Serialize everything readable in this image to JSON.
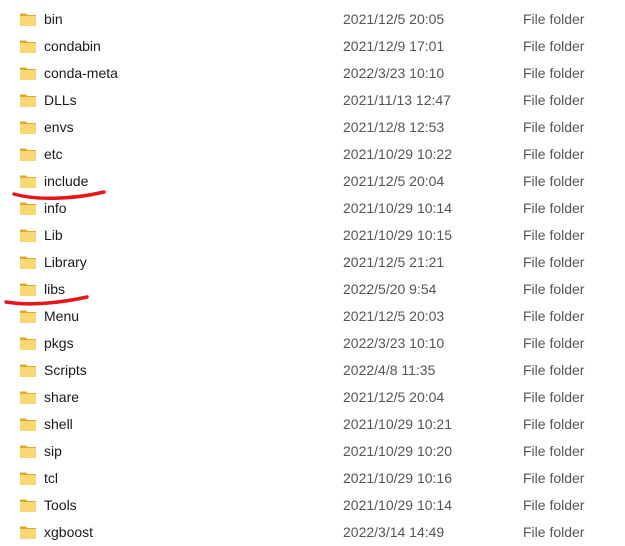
{
  "folders": [
    {
      "name": "bin",
      "date": "2021/12/5 20:05",
      "type": "File folder"
    },
    {
      "name": "condabin",
      "date": "2021/12/9 17:01",
      "type": "File folder"
    },
    {
      "name": "conda-meta",
      "date": "2022/3/23 10:10",
      "type": "File folder"
    },
    {
      "name": "DLLs",
      "date": "2021/11/13 12:47",
      "type": "File folder"
    },
    {
      "name": "envs",
      "date": "2021/12/8 12:53",
      "type": "File folder"
    },
    {
      "name": "etc",
      "date": "2021/10/29 10:22",
      "type": "File folder"
    },
    {
      "name": "include",
      "date": "2021/12/5 20:04",
      "type": "File folder",
      "underlined": true
    },
    {
      "name": "info",
      "date": "2021/10/29 10:14",
      "type": "File folder"
    },
    {
      "name": "Lib",
      "date": "2021/10/29 10:15",
      "type": "File folder"
    },
    {
      "name": "Library",
      "date": "2021/12/5 21:21",
      "type": "File folder"
    },
    {
      "name": "libs",
      "date": "2022/5/20 9:54",
      "type": "File folder",
      "underlined": true
    },
    {
      "name": "Menu",
      "date": "2021/12/5 20:03",
      "type": "File folder"
    },
    {
      "name": "pkgs",
      "date": "2022/3/23 10:10",
      "type": "File folder"
    },
    {
      "name": "Scripts",
      "date": "2022/4/8 11:35",
      "type": "File folder"
    },
    {
      "name": "share",
      "date": "2021/12/5 20:04",
      "type": "File folder"
    },
    {
      "name": "shell",
      "date": "2021/10/29 10:21",
      "type": "File folder"
    },
    {
      "name": "sip",
      "date": "2021/10/29 10:20",
      "type": "File folder"
    },
    {
      "name": "tcl",
      "date": "2021/10/29 10:16",
      "type": "File folder"
    },
    {
      "name": "Tools",
      "date": "2021/10/29 10:14",
      "type": "File folder"
    },
    {
      "name": "xgboost",
      "date": "2022/3/14 14:49",
      "type": "File folder"
    }
  ],
  "icon": "folder-icon",
  "colors": {
    "folder_front": "#f8d775",
    "folder_back": "#e0a82e",
    "annotation": "#e8141b"
  }
}
